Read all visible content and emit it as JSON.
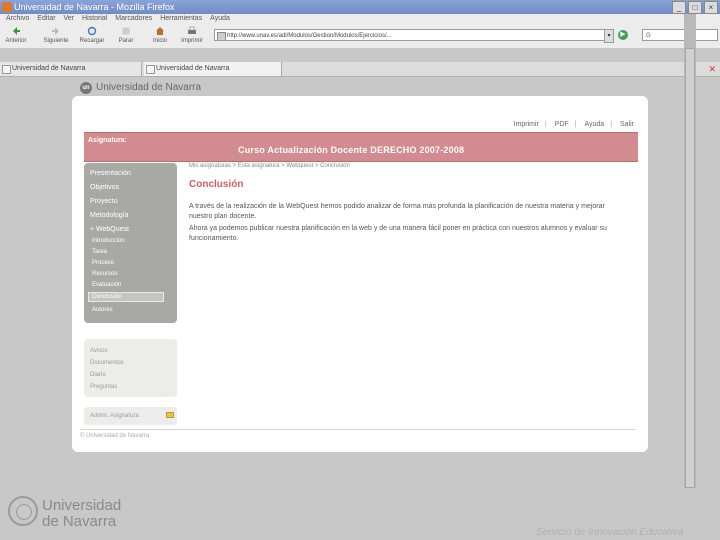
{
  "window": {
    "title": "Universidad de Navarra - Mozilla Firefox"
  },
  "menu": [
    "Archivo",
    "Editar",
    "Ver",
    "Historial",
    "Marcadores",
    "Herramientas",
    "Ayuda"
  ],
  "toolbar": {
    "back": "Anterior",
    "forward": "Siguiente",
    "reload": "Recargar",
    "stop": "Parar",
    "home": "Inicio",
    "print": "Imprimir",
    "url": "http://www.unav.es/adi/Modulos/Gestion/Modulos/Ejercicios/...",
    "search_placeholder": "G"
  },
  "tabs": [
    {
      "label": "Universidad de Navarra"
    },
    {
      "label": "Universidad de Navarra"
    }
  ],
  "page": {
    "header": "Universidad de Navarra",
    "logo_text": "un",
    "top_links": [
      "Imprimir",
      "PDF",
      "Ayuda",
      "Salir"
    ],
    "banner_label": "Asignatura:",
    "course_title": "Curso Actualización Docente DERECHO   2007-2008",
    "nav": {
      "items": [
        "Presentación",
        "Objetivos",
        "Proyecto",
        "Metodología",
        "+ WebQuest"
      ],
      "subitems": [
        "Introducción",
        "Tarea",
        "Proceso",
        "Recursos",
        "Evaluación",
        "Conclusión",
        "Autores"
      ],
      "active": "Conclusión"
    },
    "secondary_nav": [
      "Avisos",
      "Documentos",
      "Diario",
      "Preguntas"
    ],
    "admin_label": "Admin. Asignatura",
    "breadcrumb": "Mis asignaturas > Esta asignatura > Webquest > Conclusión",
    "title": "Conclusión",
    "paragraph1": "A través de la realización de la WebQuest hemos podido analizar de forma más profunda la planificación de nuestra materia y mejorar nuestro plan docente.",
    "paragraph2": "Ahora ya podemos publicar nuestra planificación en la web y de una manera fácil poner en práctica con nuestros alumnos y evaluar su funcionamiento.",
    "copyright": "© Universidad de Navarra"
  },
  "branding": {
    "line1": "Universidad",
    "line2": "de Navarra",
    "service": "Servicio de Innovación Educativa"
  }
}
